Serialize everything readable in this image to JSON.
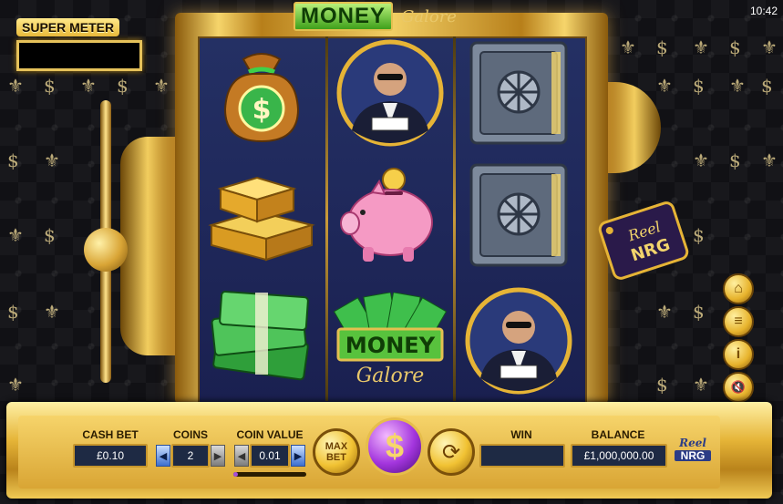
{
  "status_bar": {
    "time": "10:42"
  },
  "super_meter": {
    "label": "SUPER METER",
    "value": ""
  },
  "logo": {
    "word1": "MONEY",
    "word2": "Galore"
  },
  "brand": {
    "line1": "Reel",
    "line2": "NRG"
  },
  "reels": [
    {
      "symbols": [
        "money-bag",
        "gold-bars",
        "cash-stack"
      ]
    },
    {
      "symbols": [
        "boss-portrait",
        "piggy-bank",
        "money-galore-logo"
      ]
    },
    {
      "symbols": [
        "vault-safe",
        "vault-safe",
        "boss-portrait"
      ]
    }
  ],
  "reel_symbol_text": {
    "dollar": "$",
    "money": "MONEY",
    "galore": "Galore"
  },
  "side_menu": [
    {
      "name": "home-icon",
      "glyph": "⌂"
    },
    {
      "name": "menu-icon",
      "glyph": "≡"
    },
    {
      "name": "info-icon",
      "glyph": "i"
    },
    {
      "name": "sound-off-icon",
      "glyph": "🔇"
    },
    {
      "name": "settings-icon",
      "glyph": "⚙"
    },
    {
      "name": "close-icon",
      "glyph": "✕"
    }
  ],
  "controls": {
    "cash_bet": {
      "label": "CASH BET",
      "value": "£0.10"
    },
    "coins": {
      "label": "COINS",
      "value": "2",
      "left": "◀",
      "right": "▶"
    },
    "coin_value": {
      "label": "COIN VALUE",
      "value": "0.01",
      "left": "◀",
      "right": "▶",
      "progress": 0.06
    },
    "max_bet": {
      "line1": "MAX",
      "line2": "BET"
    },
    "spin": {
      "glyph": "$"
    },
    "autoplay": {
      "glyph": "⟳"
    },
    "win": {
      "label": "WIN",
      "value": ""
    },
    "balance": {
      "label": "BALANCE",
      "value": "£1,000,000.00"
    }
  },
  "colors": {
    "gold": "#e6b436",
    "reel_bg": "#1f2757",
    "spin_purple": "#a335dd",
    "field_bg": "#1e2a44"
  }
}
